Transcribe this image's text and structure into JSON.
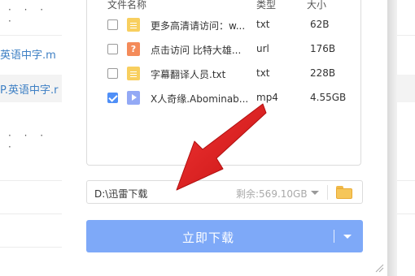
{
  "background": {
    "dots_top": "· · · ·",
    "link1": "英语中字.m",
    "link2": "P.英语中字.r",
    "dots_mid": "· · · ·"
  },
  "dialog": {
    "columns": {
      "name": "文件名称",
      "type": "类型",
      "size": "大小"
    },
    "files": [
      {
        "name": "更多高清请访问：w...",
        "type": "txt",
        "size": "62B",
        "icon": "txt-file-icon",
        "checked": false
      },
      {
        "name": "点击访问 比特大雄...",
        "type": "url",
        "size": "176B",
        "icon": "url-file-icon",
        "checked": false
      },
      {
        "name": "字幕翻译人员.txt",
        "type": "txt",
        "size": "228B",
        "icon": "txt-file-icon",
        "checked": false
      },
      {
        "name": "X人奇缘.Abominab...",
        "type": "mp4",
        "size": "4.55GB",
        "icon": "video-file-icon",
        "checked": true
      }
    ],
    "url_icon_glyph": "?",
    "path": {
      "value": "D:\\迅雷下载",
      "free_space": "剩余:569.10GB"
    },
    "download_button": "立即下载"
  },
  "colors": {
    "accent": "#7ea9f8",
    "checkbox": "#4f8ff7",
    "arrow": "#e52222"
  }
}
